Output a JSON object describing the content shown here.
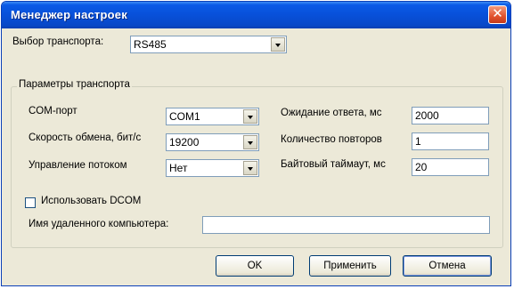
{
  "window": {
    "title": "Менеджер настроек",
    "close_symbol": "✕"
  },
  "transport": {
    "label": "Выбор транспорта:",
    "value": "RS485"
  },
  "params": {
    "group_title": "Параметры транспорта",
    "com_port": {
      "label": "COM-порт",
      "value": "COM1"
    },
    "baud_rate": {
      "label": "Скорость обмена, бит/с",
      "value": "19200"
    },
    "flow_control": {
      "label": "Управление потоком",
      "value": "Нет"
    },
    "response_timeout": {
      "label": "Ожидание ответа, мс",
      "value": "2000"
    },
    "retries": {
      "label": "Количество повторов",
      "value": "1"
    },
    "byte_timeout": {
      "label": "Байтовый таймаут, мс",
      "value": "20"
    }
  },
  "dcom": {
    "checkbox_label": "Использовать DCOM",
    "checked": false,
    "remote_label": "Имя удаленного компьютера:",
    "remote_value": ""
  },
  "buttons": {
    "ok": "OK",
    "apply": "Применить",
    "cancel": "Отмена"
  },
  "colors": {
    "titlebar": "#0850d9",
    "window_bg": "#ece9d8",
    "close_button": "#e2522e"
  },
  "icons": {
    "close": "close-icon",
    "dropdown": "chevron-down-icon"
  }
}
